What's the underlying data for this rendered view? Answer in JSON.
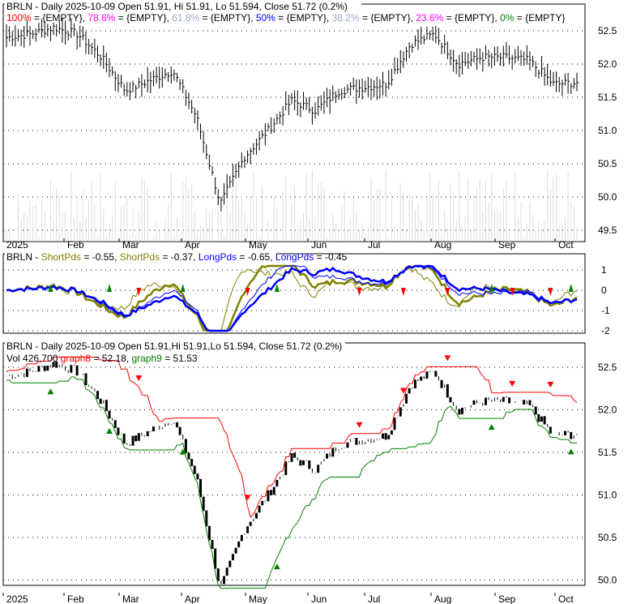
{
  "panel1": {
    "title": "BRLN - Daily 2025-10-09 Open 51.91, Hi 51.91, Lo 51.594, Close 51.72 (0.2%)",
    "fib": [
      {
        "label": "100%",
        "value": " = {EMPTY}, ",
        "color": "#ff0000"
      },
      {
        "label": "78.6%",
        "value": " = {EMPTY}, ",
        "color": "#ff00ff"
      },
      {
        "label": "61.8%",
        "value": " = {EMPTY}, ",
        "color": "#99aacc"
      },
      {
        "label": "50%",
        "value": " = {EMPTY}, ",
        "color": "#0000ff"
      },
      {
        "label": "38.2%",
        "value": " = {EMPTY}, ",
        "color": "#99aacc"
      },
      {
        "label": "23.6%",
        "value": " = {EMPTY}, ",
        "color": "#ff00ff"
      },
      {
        "label": "0%",
        "value": " = {EMPTY}",
        "color": "#008000"
      }
    ]
  },
  "panel2": {
    "prefix": "BRLN - ",
    "items": [
      {
        "label": "ShortPds",
        "value": " = -0.55, ",
        "color": "#808000"
      },
      {
        "label": "ShortPds",
        "value": " = -0.37, ",
        "color": "#808000"
      },
      {
        "label": "LongPds",
        "value": " = -0.65, ",
        "color": "#0000ff"
      },
      {
        "label": "LongPds",
        "value": " = -0.45",
        "color": "#0000ff"
      }
    ]
  },
  "panel3": {
    "title": "BRLN - Daily 2025-10-09 Open 51.91,Hi 51.91,Lo 51.594, Close 51.72 (0.2%)",
    "vol": "Vol 426,700 ",
    "g8": "graph8",
    "g8v": " = 52.18, ",
    "g9": "graph9",
    "g9v": " = 51.53"
  },
  "chart_data": {
    "type": "line",
    "months": [
      "2025",
      "Feb",
      "Mar",
      "Apr",
      "May",
      "Jun",
      "Jul",
      "Aug",
      "Sep",
      "Oct"
    ],
    "price_ticks": [
      "52.5",
      "52.0",
      "51.5",
      "51.0",
      "50.5",
      "50.0",
      "49.5"
    ],
    "osc_ticks": [
      "1",
      "0",
      "-1",
      "-2"
    ],
    "price_ticks3": [
      "52.5",
      "52.0",
      "51.5",
      "51.0",
      "50.5",
      "50.0"
    ],
    "approx_close_keypoints": [
      52.4,
      52.45,
      52.55,
      52.45,
      52.1,
      51.6,
      51.75,
      51.9,
      51.2,
      49.9,
      50.6,
      51.0,
      51.45,
      51.3,
      51.6,
      51.65,
      51.7,
      52.3,
      52.45,
      52.0,
      52.1,
      52.1,
      52.05,
      51.7,
      51.72
    ],
    "last": {
      "open": 51.91,
      "high": 51.91,
      "low": 51.594,
      "close": 51.72,
      "change_pct": 0.2,
      "volume": 426700
    },
    "graph8": 52.18,
    "graph9": 51.53
  }
}
